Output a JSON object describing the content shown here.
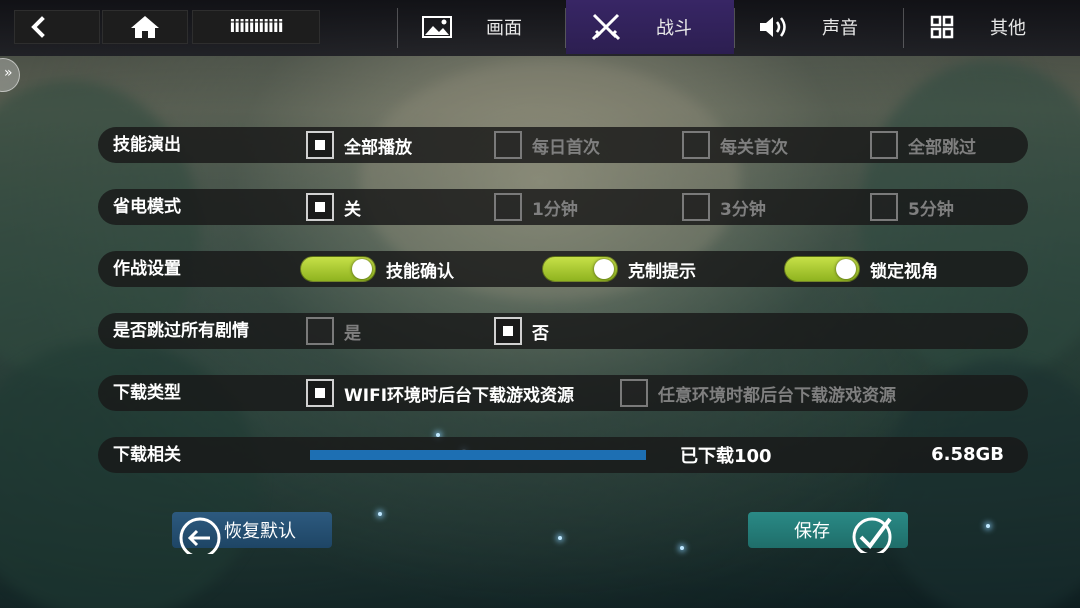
{
  "header": {
    "user_name": "iiiiiiiiiii",
    "tabs": [
      {
        "label": "画面",
        "icon": "image-icon"
      },
      {
        "label": "战斗",
        "icon": "crossed-swords-icon",
        "active": true
      },
      {
        "label": "声音",
        "icon": "speaker-icon"
      },
      {
        "label": "其他",
        "icon": "grid-icon"
      }
    ]
  },
  "settings": {
    "skill_anim": {
      "label": "技能演出",
      "options": [
        "全部播放",
        "每日首次",
        "每关首次",
        "全部跳过"
      ],
      "selected_index": 0
    },
    "power_save": {
      "label": "省电模式",
      "options": [
        "关",
        "1分钟",
        "3分钟",
        "5分钟"
      ],
      "selected_index": 0
    },
    "battle": {
      "label": "作战设置",
      "toggles": [
        {
          "label": "技能确认",
          "on": true
        },
        {
          "label": "克制提示",
          "on": true
        },
        {
          "label": "锁定视角",
          "on": true
        }
      ]
    },
    "skip_story": {
      "label": "是否跳过所有剧情",
      "options": [
        "是",
        "否"
      ],
      "selected_index": 1
    },
    "download_type": {
      "label": "下载类型",
      "options": [
        "WIFI环境时后台下载游戏资源",
        "任意环境时都后台下载游戏资源"
      ],
      "selected_index": 0
    },
    "download": {
      "label": "下载相关",
      "progress_text": "已下载100",
      "progress_percent": 100,
      "size": "6.58GB"
    }
  },
  "buttons": {
    "restore": "恢复默认",
    "save": "保存"
  },
  "colors": {
    "toggle_on": "#a8c933",
    "progress": "#1d6fb3",
    "active_tab": "#3c286e",
    "save_button": "#23807c",
    "restore_button": "#244f73"
  }
}
